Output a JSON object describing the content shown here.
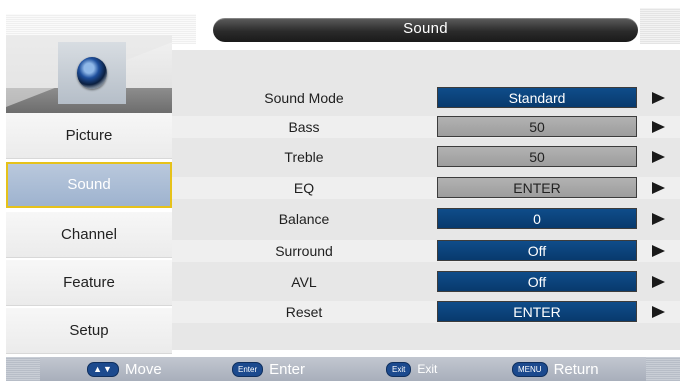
{
  "header": {
    "title": "Sound"
  },
  "sidebar": {
    "items": [
      {
        "label": "Picture",
        "selected": false
      },
      {
        "label": "Sound",
        "selected": true
      },
      {
        "label": "Channel",
        "selected": false
      },
      {
        "label": "Feature",
        "selected": false
      },
      {
        "label": "Setup",
        "selected": false
      }
    ],
    "header_icon": "speaker-icon"
  },
  "settings": [
    {
      "label": "Sound Mode",
      "value": "Standard",
      "style": "blue"
    },
    {
      "label": "Bass",
      "value": "50",
      "style": "gray"
    },
    {
      "label": "Treble",
      "value": "50",
      "style": "gray"
    },
    {
      "label": "EQ",
      "value": "ENTER",
      "style": "gray"
    },
    {
      "label": "Balance",
      "value": "0",
      "style": "blue"
    },
    {
      "label": "Surround",
      "value": "Off",
      "style": "blue"
    },
    {
      "label": "AVL",
      "value": "Off",
      "style": "blue"
    },
    {
      "label": "Reset",
      "value": "ENTER",
      "style": "blue"
    }
  ],
  "footer": {
    "hints": [
      {
        "key": "▲▼",
        "label": "Move"
      },
      {
        "key": "Enter",
        "label": "Enter"
      },
      {
        "key": "Exit",
        "label": "Exit"
      },
      {
        "key": "MENU",
        "label": "Return"
      }
    ]
  },
  "colors": {
    "value_blue": "#0b4580",
    "value_gray": "#a8a8a8",
    "selected_item": "#a9bcd6",
    "selected_border": "#e6c21a",
    "title_bar": "#2b2b2b"
  }
}
